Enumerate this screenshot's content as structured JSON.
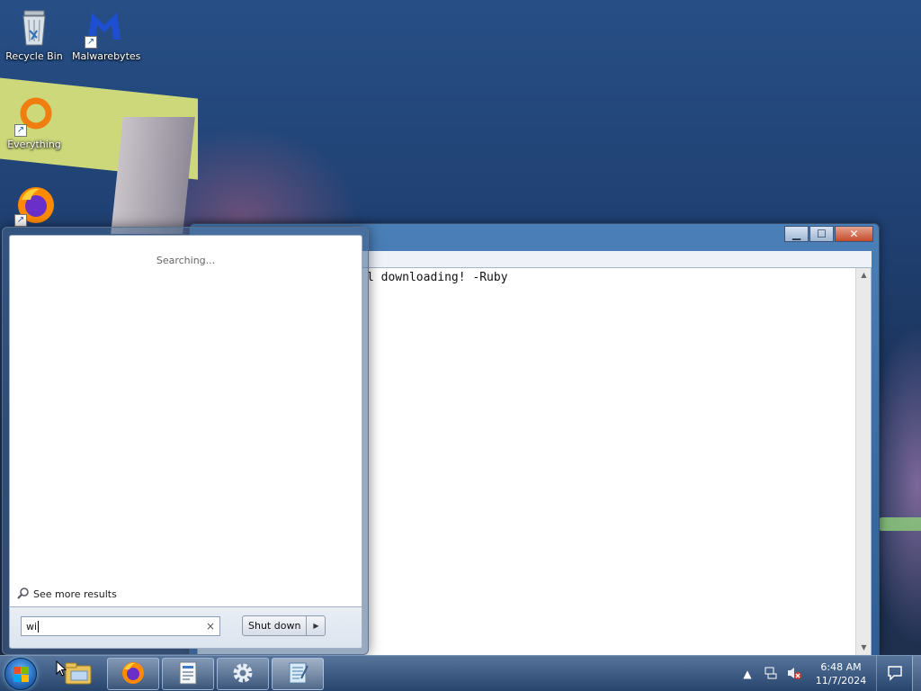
{
  "desktop": {
    "icons": [
      {
        "name": "recycle-bin",
        "label": "Recycle Bin"
      },
      {
        "name": "malwarebytes",
        "label": "Malwarebytes"
      },
      {
        "name": "everything",
        "label": "Everything"
      },
      {
        "name": "firefox",
        "label": ""
      }
    ]
  },
  "window": {
    "app": "Notepad",
    "content_text": "l downloading! -Ruby",
    "controls": {
      "minimize": "▁",
      "maximize": "☐",
      "close": "✕"
    }
  },
  "start_menu": {
    "status_text": "Searching...",
    "see_more_label": "See more results",
    "search_value": "wi",
    "clear_symbol": "×",
    "shutdown_label": "Shut down",
    "shutdown_arrow": "▶"
  },
  "taskbar": {
    "pinned": [
      {
        "name": "windows-explorer",
        "icon": "folder-icon"
      },
      {
        "name": "firefox",
        "icon": "firefox-icon"
      },
      {
        "name": "notepad-doc",
        "icon": "document-icon"
      },
      {
        "name": "settings",
        "icon": "gear-icon"
      },
      {
        "name": "notepad",
        "icon": "notepad-icon"
      }
    ],
    "tray": {
      "show_hidden": "▲",
      "time": "6:48 AM",
      "date": "11/7/2024"
    }
  },
  "colors": {
    "accent": "#2a6fc0",
    "desktop_bg": "#274f86",
    "window_title": "#4a7fb8"
  }
}
